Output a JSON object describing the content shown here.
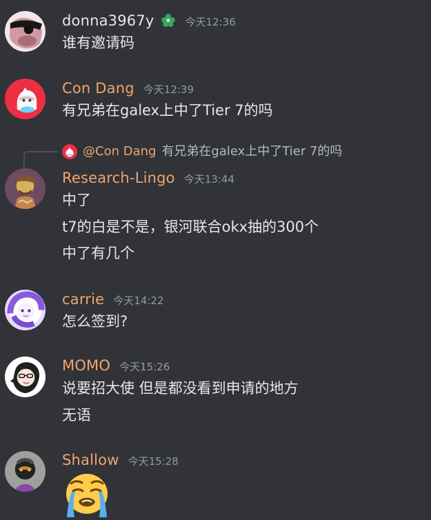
{
  "messages": [
    {
      "username": "donna3967y",
      "timestamp": "今天12:36",
      "icon": "nitro-badge-icon",
      "lines": [
        "谁有邀请码"
      ]
    },
    {
      "username": "Con Dang",
      "timestamp": "今天12:39",
      "lines": [
        "有兄弟在galex上中了Tier 7的吗"
      ]
    },
    {
      "username": "Research-Lingo",
      "timestamp": "今天13:44",
      "reply": {
        "username": "@Con Dang",
        "text": "有兄弟在galex上中了Tier 7的吗"
      },
      "lines": [
        "中了",
        "t7的白是不是，银河联合okx抽的300个",
        "中了有几个"
      ]
    },
    {
      "username": "carrie",
      "timestamp": "今天14:22",
      "lines": [
        "怎么签到?"
      ]
    },
    {
      "username": "MOMO",
      "timestamp": "今天15:26",
      "lines": [
        "说要招大使 但是都没看到申请的地方",
        "无语"
      ]
    },
    {
      "username": "Shallow",
      "timestamp": "今天15:28",
      "emoji": "loudly-crying-face-icon"
    }
  ],
  "colors": {
    "background": "#313338",
    "username_gray": "#e5e7ea",
    "username_orange": "#f3a46d",
    "timestamp": "#949ba4",
    "text": "#e5e7ea",
    "reply_text": "#b5bac1",
    "badge_green": "#3ba55d"
  }
}
